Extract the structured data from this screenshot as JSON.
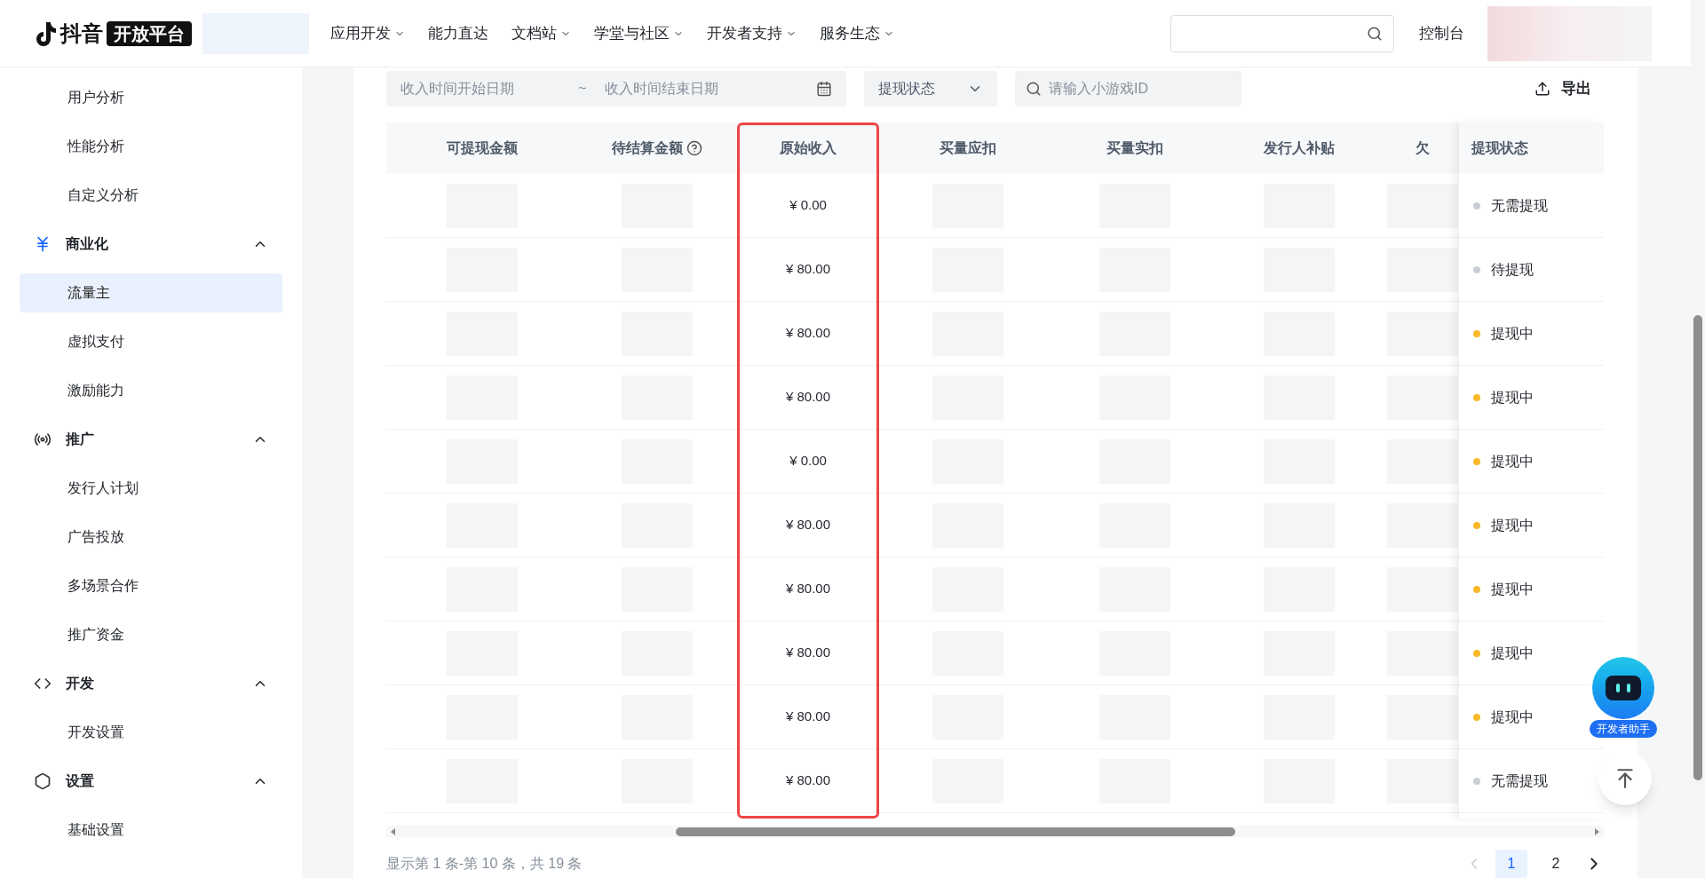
{
  "header": {
    "logo": {
      "brand": "抖音",
      "badge": "开放平台"
    },
    "nav": [
      {
        "label": "应用开发",
        "has_dropdown": true
      },
      {
        "label": "能力直达",
        "has_dropdown": false
      },
      {
        "label": "文档站",
        "has_dropdown": true
      },
      {
        "label": "学堂与社区",
        "has_dropdown": true
      },
      {
        "label": "开发者支持",
        "has_dropdown": true
      },
      {
        "label": "服务生态",
        "has_dropdown": true
      }
    ],
    "console": "控制台"
  },
  "sidebar": {
    "loose_items": [
      {
        "label": "用户分析",
        "selected": false
      },
      {
        "label": "性能分析",
        "selected": false
      },
      {
        "label": "自定义分析",
        "selected": false
      }
    ],
    "groups": [
      {
        "title": "商业化",
        "expanded": true,
        "items": [
          {
            "label": "流量主",
            "selected": true
          },
          {
            "label": "虚拟支付",
            "selected": false
          },
          {
            "label": "激励能力",
            "selected": false
          }
        ]
      },
      {
        "title": "推广",
        "expanded": true,
        "items": [
          {
            "label": "发行人计划",
            "selected": false
          },
          {
            "label": "广告投放",
            "selected": false
          },
          {
            "label": "多场景合作",
            "selected": false
          },
          {
            "label": "推广资金",
            "selected": false
          }
        ]
      },
      {
        "title": "开发",
        "expanded": true,
        "items": [
          {
            "label": "开发设置",
            "selected": false
          }
        ]
      },
      {
        "title": "设置",
        "expanded": true,
        "items": [
          {
            "label": "基础设置",
            "selected": false
          }
        ]
      }
    ]
  },
  "filters": {
    "start_date": {
      "placeholder": "收入时间开始日期"
    },
    "separator": "~",
    "end_date": {
      "placeholder": "收入时间结束日期"
    },
    "status_select": {
      "placeholder": "提现状态"
    },
    "search": {
      "placeholder": "请输入小游戏ID"
    },
    "export": "导出"
  },
  "table": {
    "columns": [
      {
        "label": "可提现金额",
        "help": false,
        "highlighted": false
      },
      {
        "label": "待结算金额",
        "help": true,
        "highlighted": false
      },
      {
        "label": "原始收入",
        "help": false,
        "highlighted": true
      },
      {
        "label": "买量应扣",
        "help": false,
        "highlighted": false
      },
      {
        "label": "买量实扣",
        "help": false,
        "highlighted": false
      },
      {
        "label": "发行人补贴",
        "help": false,
        "highlighted": false
      },
      {
        "label": "欠",
        "help": false,
        "highlighted": false
      }
    ],
    "fixed_column": "提现状态",
    "rows": [
      {
        "original_income": "¥ 0.00",
        "status": {
          "label": "无需提现",
          "color": "#c9cdd4"
        }
      },
      {
        "original_income": "¥ 80.00",
        "status": {
          "label": "待提现",
          "color": "#c9cdd4"
        }
      },
      {
        "original_income": "¥ 80.00",
        "status": {
          "label": "提现中",
          "color": "#fbb829"
        }
      },
      {
        "original_income": "¥ 80.00",
        "status": {
          "label": "提现中",
          "color": "#fbb829"
        }
      },
      {
        "original_income": "¥ 0.00",
        "status": {
          "label": "提现中",
          "color": "#fbb829"
        }
      },
      {
        "original_income": "¥ 80.00",
        "status": {
          "label": "提现中",
          "color": "#fbb829"
        }
      },
      {
        "original_income": "¥ 80.00",
        "status": {
          "label": "提现中",
          "color": "#fbb829"
        }
      },
      {
        "original_income": "¥ 80.00",
        "status": {
          "label": "提现中",
          "color": "#fbb829"
        }
      },
      {
        "original_income": "¥ 80.00",
        "status": {
          "label": "提现中",
          "color": "#fbb829"
        }
      },
      {
        "original_income": "¥ 80.00",
        "status": {
          "label": "无需提现",
          "color": "#c9cdd4"
        }
      }
    ]
  },
  "footer": {
    "summary": "显示第 1 条-第 10 条，共 19 条",
    "prev_disabled": true,
    "pages": [
      {
        "label": "1",
        "selected": true
      },
      {
        "label": "2",
        "selected": false
      }
    ]
  },
  "assistant": {
    "label": "开发者助手"
  }
}
